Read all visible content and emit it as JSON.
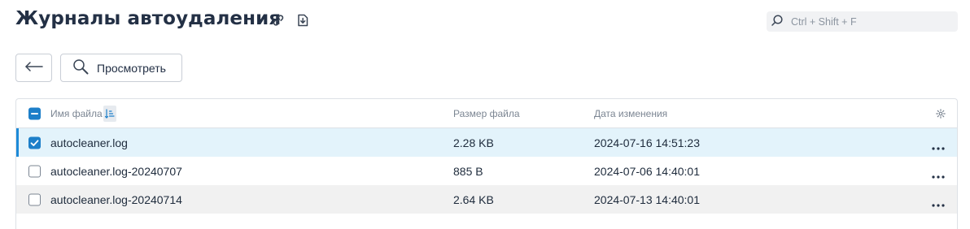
{
  "page": {
    "title": "Журналы автоудаления"
  },
  "icons": {
    "link": "link-icon",
    "export": "export-icon",
    "search": "search-icon",
    "back": "arrow-left-icon",
    "view": "magnifier-icon",
    "sort": "sort-icon",
    "settings": "gear-icon",
    "more": "more-icon"
  },
  "search": {
    "placeholder": "Ctrl + Shift + F",
    "value": ""
  },
  "toolbar": {
    "view_label": "Просмотреть"
  },
  "table": {
    "columns": {
      "name": "Имя файла",
      "size": "Размер файла",
      "date": "Дата изменения"
    },
    "header_checkbox_state": "partial",
    "rows": [
      {
        "name": "autocleaner.log",
        "size": "2.28 KB",
        "date": "2024-07-16 14:51:23",
        "checked": true
      },
      {
        "name": "autocleaner.log-20240707",
        "size": "885 B",
        "date": "2024-07-06 14:40:01",
        "checked": false
      },
      {
        "name": "autocleaner.log-20240714",
        "size": "2.64 KB",
        "date": "2024-07-13 14:40:01",
        "checked": false
      }
    ]
  },
  "colors": {
    "accent": "#1d7fc9",
    "selected_row_bg": "#e3f3fb",
    "alt_row_bg": "#f1f1f1",
    "title": "#233045"
  }
}
